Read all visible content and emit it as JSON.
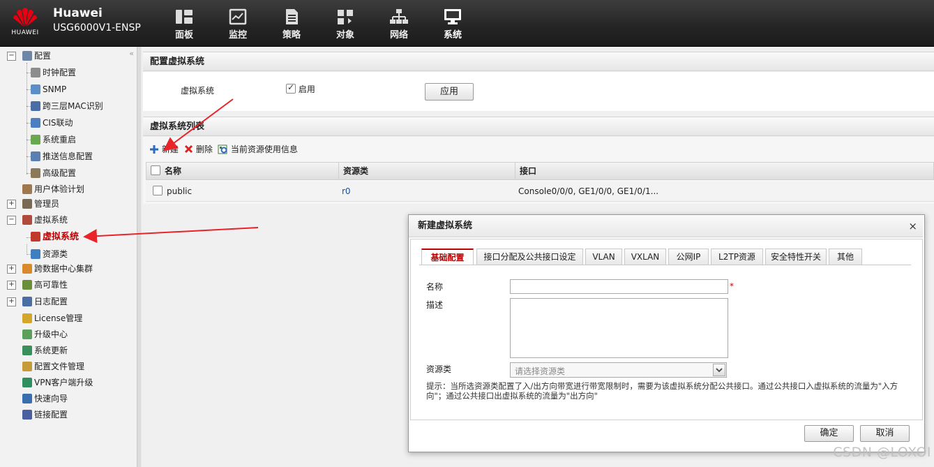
{
  "brand": {
    "logo_text": "HUAWEI",
    "product_name": "Huawei",
    "model": "USG6000V1-ENSP"
  },
  "nav": [
    {
      "label": "面板",
      "icon": "dashboard-icon"
    },
    {
      "label": "监控",
      "icon": "monitor-icon"
    },
    {
      "label": "策略",
      "icon": "policy-icon"
    },
    {
      "label": "对象",
      "icon": "object-icon"
    },
    {
      "label": "网络",
      "icon": "network-icon"
    },
    {
      "label": "系统",
      "icon": "system-icon",
      "active": true
    }
  ],
  "sidebar": {
    "collapse_icon": "«",
    "items": [
      {
        "label": "配置",
        "level": 0,
        "expanded": true
      },
      {
        "label": "时钟配置",
        "level": 1
      },
      {
        "label": "SNMP",
        "level": 1
      },
      {
        "label": "跨三层MAC识别",
        "level": 1
      },
      {
        "label": "CIS联动",
        "level": 1
      },
      {
        "label": "系统重启",
        "level": 1
      },
      {
        "label": "推送信息配置",
        "level": 1
      },
      {
        "label": "高级配置",
        "level": 1
      },
      {
        "label": "用户体验计划",
        "level": 0
      },
      {
        "label": "管理员",
        "level": 0,
        "expanded": false
      },
      {
        "label": "虚拟系统",
        "level": 0,
        "expanded": true
      },
      {
        "label": "虚拟系统",
        "level": 1,
        "active": true
      },
      {
        "label": "资源类",
        "level": 1
      },
      {
        "label": "跨数据中心集群",
        "level": 0,
        "expanded": false
      },
      {
        "label": "高可靠性",
        "level": 0,
        "expanded": false
      },
      {
        "label": "日志配置",
        "level": 0,
        "expanded": false
      },
      {
        "label": "License管理",
        "level": 0
      },
      {
        "label": "升级中心",
        "level": 0
      },
      {
        "label": "系统更新",
        "level": 0
      },
      {
        "label": "配置文件管理",
        "level": 0
      },
      {
        "label": "VPN客户端升级",
        "level": 0
      },
      {
        "label": "快速向导",
        "level": 0
      },
      {
        "label": "链接配置",
        "level": 0
      }
    ]
  },
  "config_panel": {
    "title": "配置虚拟系统",
    "field_label": "虚拟系统",
    "enable_label": "启用",
    "enabled": true,
    "apply_button": "应用"
  },
  "list_panel": {
    "title": "虚拟系统列表",
    "toolbar": {
      "new": "新建",
      "delete": "删除",
      "resource_info": "当前资源使用信息"
    },
    "columns": [
      "名称",
      "资源类",
      "接口"
    ],
    "rows": [
      {
        "name": "public",
        "resource": "r0",
        "interfaces": "Console0/0/0,  GE1/0/0,  GE1/0/1..."
      }
    ]
  },
  "dialog": {
    "title": "新建虚拟系统",
    "close": "×",
    "tabs": [
      "基础配置",
      "接口分配及公共接口设定",
      "VLAN",
      "VXLAN",
      "公网IP",
      "L2TP资源",
      "安全特性开关",
      "其他"
    ],
    "active_tab": 0,
    "name_label": "名称",
    "name_value": "",
    "required_mark": "*",
    "desc_label": "描述",
    "desc_value": "",
    "resource_label": "资源类",
    "resource_placeholder": "请选择资源类",
    "hint": "提示：当所选资源类配置了入/出方向带宽进行带宽限制时，需要为该虚拟系统分配公共接口。通过公共接口入虚拟系统的流量为\"入方向\"；通过公共接口出虚拟系统的流量为\"出方向\"",
    "ok_button": "确定",
    "cancel_button": "取消"
  },
  "watermark": "CSDN @LOXOI",
  "colors": {
    "accent_red": "#c00000",
    "link_blue": "#1a4fa0",
    "annotation_arrow": "#e8232a"
  }
}
